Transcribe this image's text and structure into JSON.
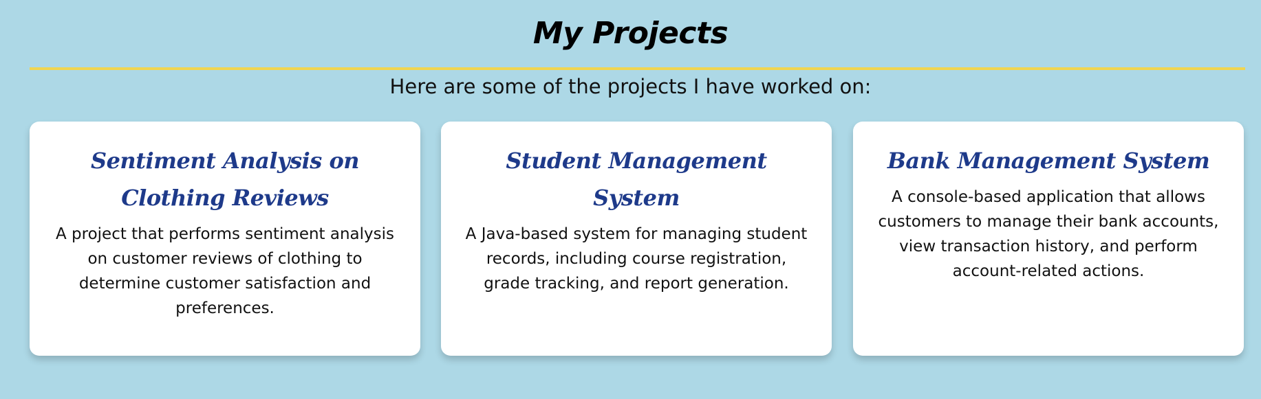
{
  "section": {
    "title": "My Projects",
    "subtitle": "Here are some of the projects I have worked on:"
  },
  "colors": {
    "background": "#add8e6",
    "divider": "#f0d550",
    "card_background": "#ffffff",
    "card_title": "#1e3a8a",
    "text": "#111111"
  },
  "projects": [
    {
      "title": "Sentiment Analysis on Clothing Reviews",
      "description": "A project that performs sentiment analysis on customer reviews of clothing to determine customer satisfaction and preferences."
    },
    {
      "title": "Student Management System",
      "description": "A Java-based system for managing student records, including course registration, grade tracking, and report generation."
    },
    {
      "title": "Bank Management System",
      "description": "A console-based application that allows customers to manage their bank accounts, view transaction history, and perform account-related actions."
    }
  ]
}
